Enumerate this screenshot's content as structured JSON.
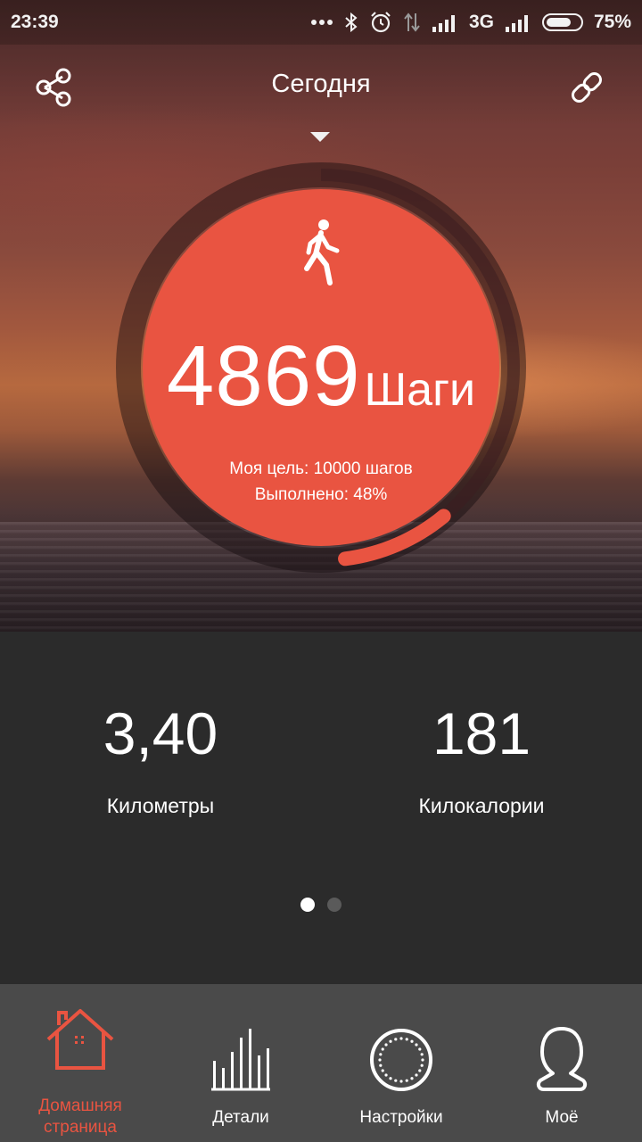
{
  "status_bar": {
    "time": "23:39",
    "network": "3G",
    "battery": "75%",
    "battery_level": 0.75
  },
  "header": {
    "title": "Сегодня",
    "left_icon": "share-icon",
    "right_icon": "link-icon"
  },
  "activity": {
    "steps": "4869",
    "steps_unit": "Шаги",
    "goal_text": "Моя цель: 10000 шагов",
    "progress_text": "Выполнено: 48%",
    "progress": 0.48,
    "icon": "walking-person-icon",
    "accent_color": "#e95441"
  },
  "stats": [
    {
      "value": "3,40",
      "label": "Километры"
    },
    {
      "value": "181",
      "label": "Килокалории"
    }
  ],
  "pager": {
    "count": 2,
    "active": 0
  },
  "nav": {
    "active_color": "#e95441",
    "items": [
      {
        "label_line1": "Домашняя",
        "label_line2": "страница",
        "icon": "home-icon",
        "active": true
      },
      {
        "label": "Детали",
        "icon": "bar-chart-icon",
        "active": false
      },
      {
        "label": "Настройки",
        "icon": "dial-icon",
        "active": false
      },
      {
        "label": "Моё",
        "icon": "profile-icon",
        "active": false
      }
    ]
  }
}
